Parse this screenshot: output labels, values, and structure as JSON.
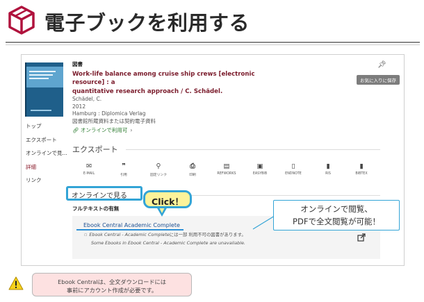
{
  "slide": {
    "title": "電子ブックを利用する",
    "logo_icon": "open-box-icon"
  },
  "record": {
    "type_label": "図書",
    "title_line1": "Work-life balance among cruise ship crews [electronic resource] : a",
    "title_line2": "quantitative research approach / C. Schädel.",
    "author": "Schädel, C.",
    "year": "2012",
    "publisher": "Hamburg : Diplomica Verlag",
    "collection": "図書館所蔵資料または契約電子資料",
    "online_link": "オンラインで利用可",
    "favorite_button": "お気に入りに保存",
    "pin_icon": "pin-icon"
  },
  "sidenav": {
    "items": [
      {
        "label": "トップ"
      },
      {
        "label": "エクスポート"
      },
      {
        "label": "オンラインで見..."
      },
      {
        "label": "詳細"
      },
      {
        "label": "リンク"
      }
    ]
  },
  "export": {
    "heading": "エクスポート",
    "items": [
      {
        "label": "E-MAIL",
        "icon": "mail-icon"
      },
      {
        "label": "引用",
        "icon": "quote-icon"
      },
      {
        "label": "固定リンク",
        "icon": "link-icon"
      },
      {
        "label": "印刷",
        "icon": "printer-icon"
      },
      {
        "label": "REFWORKS",
        "icon": "document-icon"
      },
      {
        "label": "EASYBIB",
        "icon": "export-document-icon"
      },
      {
        "label": "ENDNOTE",
        "icon": "file-icon"
      },
      {
        "label": "RIS",
        "icon": "file-icon"
      },
      {
        "label": "BIBTEX",
        "icon": "file-icon"
      }
    ]
  },
  "online": {
    "heading": "オンラインで見る",
    "fulltext_label": "フルテキストの有無",
    "source_link": "Ebook Central Academic Complete",
    "note1_prefix": "Ebook Central - Academic Complete",
    "note1_suffix": "には一部 利用不可の図書があります。",
    "note2": "Some Ebooks in Ebook Central - Academic Complete are unavailable.",
    "external_icon": "external-link-icon"
  },
  "callouts": {
    "click": "Click！",
    "info_line1": "オンラインで閲覧、",
    "info_line2": "PDFで全文閲覧が可能！"
  },
  "note": {
    "line1": "Ebook Centralは、全文ダウンロードには",
    "line2": "事前にアカウント作成が必要です。",
    "icon": "warning-icon"
  },
  "colors": {
    "brand_red": "#b0133d",
    "title_red": "#7a1b2b",
    "highlight_blue": "#33a4d6",
    "click_yellow": "#fdf39a",
    "note_pink": "#fde1e1",
    "warning_yellow": "#f7d21c"
  }
}
